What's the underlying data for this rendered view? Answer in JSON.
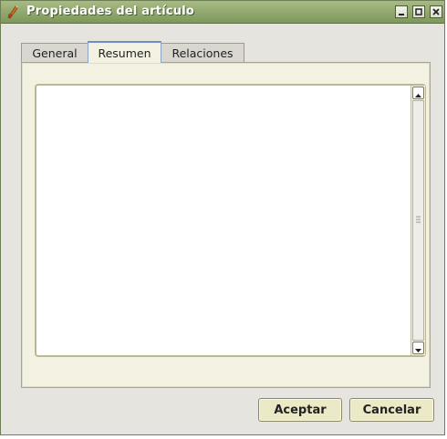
{
  "window": {
    "title": "Propiedades del artículo",
    "controls": {
      "minimize_icon": "minimize-icon",
      "maximize_icon": "maximize-icon",
      "close_icon": "close-icon"
    }
  },
  "tabs": [
    {
      "label": "General",
      "active": false
    },
    {
      "label": "Resumen",
      "active": true
    },
    {
      "label": "Relaciones",
      "active": false
    }
  ],
  "summary_text": "",
  "buttons": {
    "accept": "Aceptar",
    "cancel": "Cancelar"
  },
  "colors": {
    "titlebar": "#8aa266",
    "panel": "#f3f1e2",
    "button": "#ece9c6",
    "active_tab_accent": "#6d8dc4"
  }
}
